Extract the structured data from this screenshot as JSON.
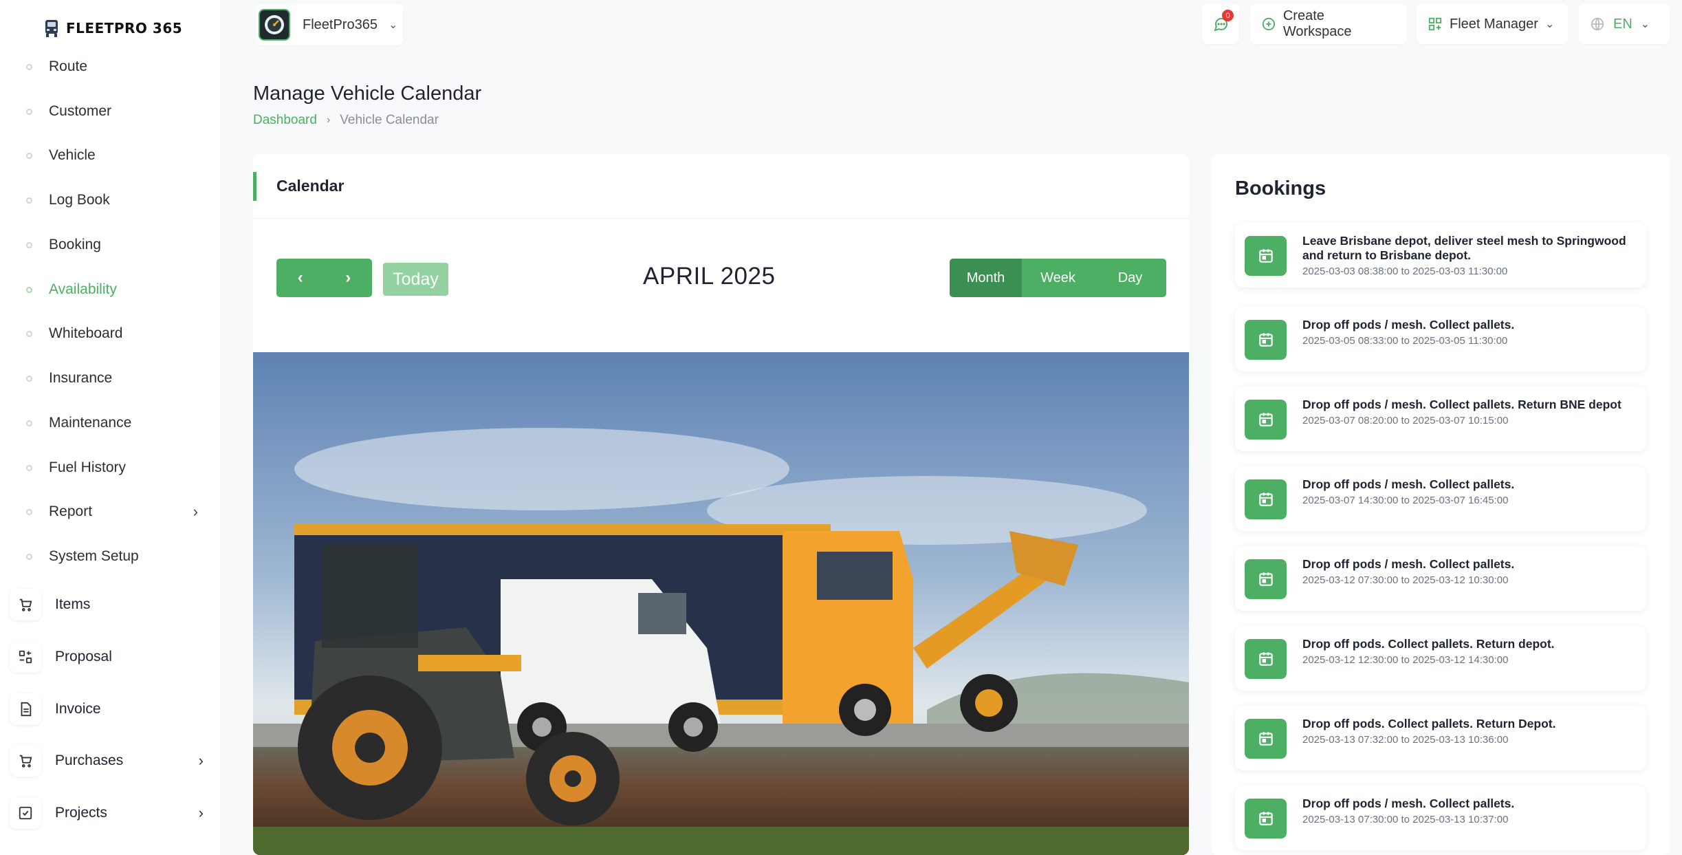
{
  "brand": {
    "name": "FLEETPRO 365"
  },
  "sidebar": {
    "sub_items": [
      {
        "label": "Route"
      },
      {
        "label": "Customer"
      },
      {
        "label": "Vehicle"
      },
      {
        "label": "Log Book"
      },
      {
        "label": "Booking"
      },
      {
        "label": "Availability",
        "active": true
      },
      {
        "label": "Whiteboard"
      },
      {
        "label": "Insurance"
      },
      {
        "label": "Maintenance"
      },
      {
        "label": "Fuel History"
      },
      {
        "label": "Report",
        "has_children": true
      },
      {
        "label": "System Setup"
      }
    ],
    "main_items": [
      {
        "label": "Items",
        "icon": "cart-icon"
      },
      {
        "label": "Proposal",
        "icon": "proposal-icon"
      },
      {
        "label": "Invoice",
        "icon": "invoice-icon"
      },
      {
        "label": "Purchases",
        "icon": "cart-icon",
        "has_children": true
      },
      {
        "label": "Projects",
        "icon": "checkbox-icon",
        "has_children": true
      }
    ]
  },
  "header": {
    "workspace": "FleetPro365",
    "messages_badge": "0",
    "create_workspace": "Create Workspace",
    "role": "Fleet Manager",
    "language": "EN"
  },
  "page": {
    "title": "Manage Vehicle Calendar",
    "breadcrumb": {
      "home": "Dashboard",
      "current": "Vehicle Calendar"
    }
  },
  "calendar": {
    "title": "Calendar",
    "today": "Today",
    "month_label": "APRIL 2025",
    "views": [
      "Month",
      "Week",
      "Day"
    ],
    "active_view": "Month"
  },
  "bookings": {
    "title": "Bookings",
    "items": [
      {
        "desc": "Leave Brisbane depot, deliver steel mesh to Springwood and return to Brisbane depot.",
        "time": "2025-03-03 08:38:00 to 2025-03-03 11:30:00"
      },
      {
        "desc": "Drop off pods / mesh. Collect pallets.",
        "time": "2025-03-05 08:33:00 to 2025-03-05 11:30:00"
      },
      {
        "desc": "Drop off pods / mesh. Collect pallets. Return BNE depot",
        "time": "2025-03-07 08:20:00 to 2025-03-07 10:15:00"
      },
      {
        "desc": "Drop off pods / mesh. Collect pallets.",
        "time": "2025-03-07 14:30:00 to 2025-03-07 16:45:00"
      },
      {
        "desc": "Drop off pods / mesh. Collect pallets.",
        "time": "2025-03-12 07:30:00 to 2025-03-12 10:30:00"
      },
      {
        "desc": "Drop off pods. Collect pallets. Return depot.",
        "time": "2025-03-12 12:30:00 to 2025-03-12 14:30:00"
      },
      {
        "desc": "Drop off pods. Collect pallets. Return Depot.",
        "time": "2025-03-13 07:32:00 to 2025-03-13 10:36:00"
      },
      {
        "desc": "Drop off pods / mesh. Collect pallets.",
        "time": "2025-03-13 07:30:00 to 2025-03-13 10:37:00"
      }
    ]
  },
  "colors": {
    "accent": "#4caf64",
    "accent_dark": "#3c8f52",
    "today_btn": "#95d2a1"
  }
}
